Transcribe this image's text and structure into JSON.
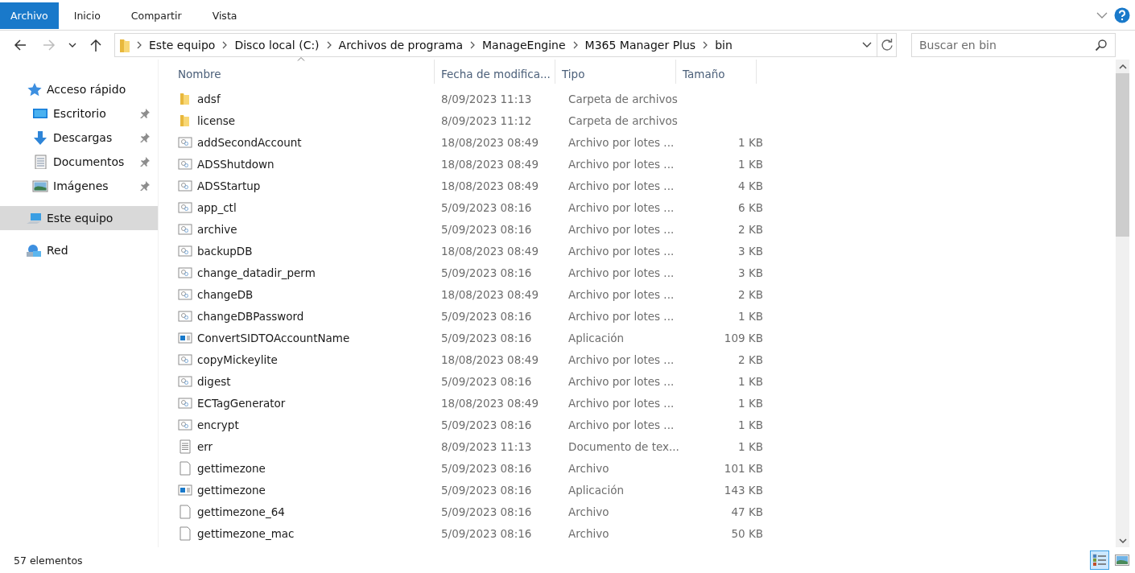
{
  "ribbon": {
    "tabs": [
      {
        "label": "Archivo",
        "selected": true
      },
      {
        "label": "Inicio",
        "selected": false
      },
      {
        "label": "Compartir",
        "selected": false
      },
      {
        "label": "Vista",
        "selected": false
      }
    ]
  },
  "address": {
    "crumbs": [
      "Este equipo",
      "Disco local (C:)",
      "Archivos de programa",
      "ManageEngine",
      "M365 Manager Plus",
      "bin"
    ]
  },
  "search": {
    "placeholder": "Buscar en bin"
  },
  "sidebar": {
    "items": [
      {
        "label": "Acceso rápido",
        "kind": "star",
        "pinned": false,
        "selected": false,
        "children": [
          {
            "label": "Escritorio",
            "kind": "desktop",
            "pinned": true,
            "selected": false
          },
          {
            "label": "Descargas",
            "kind": "download",
            "pinned": true,
            "selected": false
          },
          {
            "label": "Documentos",
            "kind": "document",
            "pinned": true,
            "selected": false
          },
          {
            "label": "Imágenes",
            "kind": "image",
            "pinned": true,
            "selected": false
          }
        ]
      },
      {
        "label": "Este equipo",
        "kind": "computer",
        "pinned": false,
        "selected": true
      },
      {
        "label": "Red",
        "kind": "network",
        "pinned": false,
        "selected": false
      }
    ]
  },
  "table": {
    "columns": [
      "Nombre",
      "Fecha de modifica...",
      "Tipo",
      "Tamaño"
    ],
    "rows": [
      {
        "kind": "folder",
        "name": "adsf",
        "date": "8/09/2023 11:13",
        "type": "Carpeta de archivos",
        "size": ""
      },
      {
        "kind": "folder",
        "name": "license",
        "date": "8/09/2023 11:12",
        "type": "Carpeta de archivos",
        "size": ""
      },
      {
        "kind": "batch",
        "name": "addSecondAccount",
        "date": "18/08/2023 08:49",
        "type": "Archivo por lotes ...",
        "size": "1 KB"
      },
      {
        "kind": "batch",
        "name": "ADSShutdown",
        "date": "18/08/2023 08:49",
        "type": "Archivo por lotes ...",
        "size": "1 KB"
      },
      {
        "kind": "batch",
        "name": "ADSStartup",
        "date": "18/08/2023 08:49",
        "type": "Archivo por lotes ...",
        "size": "4 KB"
      },
      {
        "kind": "batch",
        "name": "app_ctl",
        "date": "5/09/2023 08:16",
        "type": "Archivo por lotes ...",
        "size": "6 KB"
      },
      {
        "kind": "batch",
        "name": "archive",
        "date": "5/09/2023 08:16",
        "type": "Archivo por lotes ...",
        "size": "2 KB"
      },
      {
        "kind": "batch",
        "name": "backupDB",
        "date": "18/08/2023 08:49",
        "type": "Archivo por lotes ...",
        "size": "3 KB"
      },
      {
        "kind": "batch",
        "name": "change_datadir_perm",
        "date": "5/09/2023 08:16",
        "type": "Archivo por lotes ...",
        "size": "3 KB"
      },
      {
        "kind": "batch",
        "name": "changeDB",
        "date": "18/08/2023 08:49",
        "type": "Archivo por lotes ...",
        "size": "2 KB"
      },
      {
        "kind": "batch",
        "name": "changeDBPassword",
        "date": "5/09/2023 08:16",
        "type": "Archivo por lotes ...",
        "size": "1 KB"
      },
      {
        "kind": "app",
        "name": "ConvertSIDTOAccountName",
        "date": "5/09/2023 08:16",
        "type": "Aplicación",
        "size": "109 KB"
      },
      {
        "kind": "batch",
        "name": "copyMickeylite",
        "date": "18/08/2023 08:49",
        "type": "Archivo por lotes ...",
        "size": "2 KB"
      },
      {
        "kind": "batch",
        "name": "digest",
        "date": "5/09/2023 08:16",
        "type": "Archivo por lotes ...",
        "size": "1 KB"
      },
      {
        "kind": "batch",
        "name": "ECTagGenerator",
        "date": "18/08/2023 08:49",
        "type": "Archivo por lotes ...",
        "size": "1 KB"
      },
      {
        "kind": "batch",
        "name": "encrypt",
        "date": "5/09/2023 08:16",
        "type": "Archivo por lotes ...",
        "size": "1 KB"
      },
      {
        "kind": "text",
        "name": "err",
        "date": "8/09/2023 11:13",
        "type": "Documento de tex...",
        "size": "1 KB"
      },
      {
        "kind": "file",
        "name": "gettimezone",
        "date": "5/09/2023 08:16",
        "type": "Archivo",
        "size": "101 KB"
      },
      {
        "kind": "app",
        "name": "gettimezone",
        "date": "5/09/2023 08:16",
        "type": "Aplicación",
        "size": "143 KB"
      },
      {
        "kind": "file",
        "name": "gettimezone_64",
        "date": "5/09/2023 08:16",
        "type": "Archivo",
        "size": "47 KB"
      },
      {
        "kind": "file",
        "name": "gettimezone_mac",
        "date": "5/09/2023 08:16",
        "type": "Archivo",
        "size": "50 KB"
      }
    ]
  },
  "status_bar": {
    "count": "57 elementos",
    "views": [
      {
        "kind": "details",
        "selected": true
      },
      {
        "kind": "large",
        "selected": false
      }
    ]
  }
}
